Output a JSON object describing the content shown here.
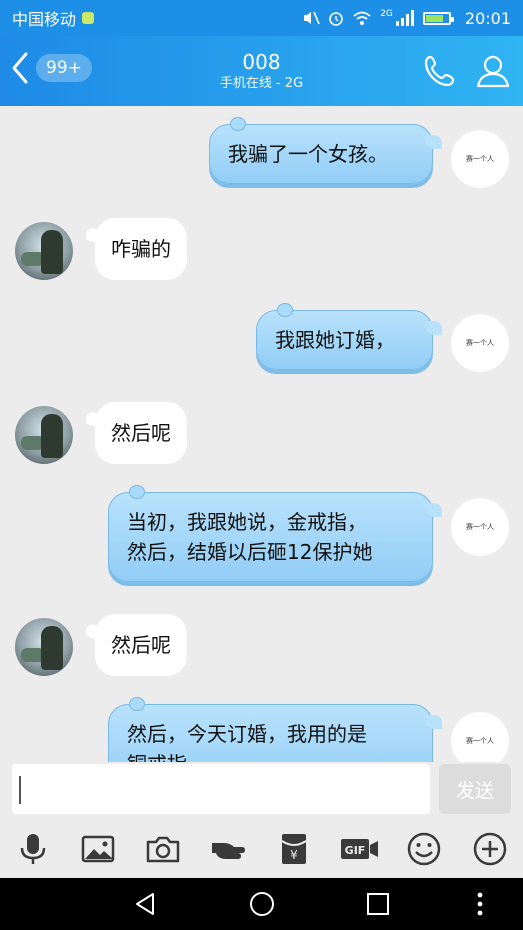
{
  "status_bar": {
    "carrier": "中国移动",
    "network": "2G",
    "time": "20:01"
  },
  "header": {
    "back_badge": "99+",
    "title": "008",
    "subtitle": "手机在线 - 2G"
  },
  "self_avatar_text": "赛一个人",
  "messages": [
    {
      "from": "self",
      "text": "我骗了一个女孩。"
    },
    {
      "from": "other",
      "text": "咋骗的"
    },
    {
      "from": "self",
      "text": "我跟她订婚，"
    },
    {
      "from": "other",
      "text": "然后呢"
    },
    {
      "from": "self",
      "line1": "当初，我跟她说，金戒指，",
      "line2": "然后，结婚以后砸12保护她"
    },
    {
      "from": "other",
      "text": "然后呢"
    },
    {
      "from": "self",
      "line1": "然后，今天订婚，我用的是",
      "line2": "铜戒指"
    }
  ],
  "composer": {
    "send_label": "发送"
  },
  "toolbar": [
    "mic-icon",
    "image-icon",
    "camera-icon",
    "poke-icon",
    "red-packet-icon",
    "gif-icon",
    "emoji-icon",
    "plus-icon"
  ],
  "colors": {
    "header_start": "#1e8ae6",
    "header_end": "#30b4f2",
    "self_bubble": "#a9dbfa",
    "chat_bg": "#ececec"
  }
}
